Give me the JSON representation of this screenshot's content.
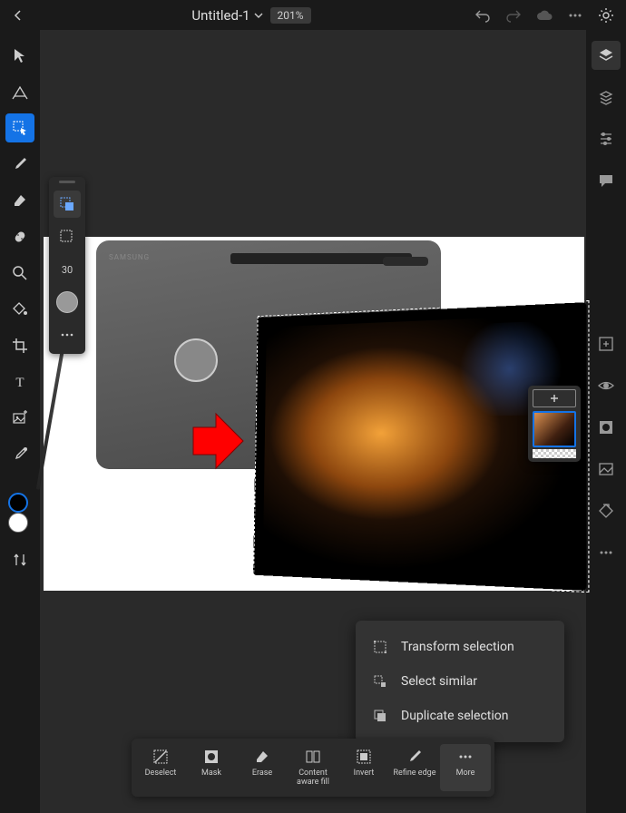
{
  "header": {
    "title": "Untitled-1",
    "zoom": "201%"
  },
  "left_tools": [
    {
      "name": "move-tool"
    },
    {
      "name": "transform-tool"
    },
    {
      "name": "selection-tool",
      "selected": true
    },
    {
      "name": "brush-tool"
    },
    {
      "name": "eraser-tool"
    },
    {
      "name": "heal-tool"
    },
    {
      "name": "magnify-tool"
    },
    {
      "name": "fill-tool"
    },
    {
      "name": "crop-tool"
    },
    {
      "name": "type-tool"
    },
    {
      "name": "place-tool"
    },
    {
      "name": "eyedropper-tool"
    }
  ],
  "tool_flyout": {
    "mode_active": "add",
    "mode_b": "subtract",
    "brush_size": "30",
    "shape": "round"
  },
  "colors": {
    "foreground": "#000000",
    "background": "#ffffff"
  },
  "right_tools": [
    {
      "name": "layers-panel",
      "selected": true
    },
    {
      "name": "layer-props-panel"
    },
    {
      "name": "adjustments-panel"
    },
    {
      "name": "comments-panel"
    }
  ],
  "right_tools_lower": [
    {
      "name": "add-layer-button"
    },
    {
      "name": "visibility-button"
    },
    {
      "name": "mask-button"
    },
    {
      "name": "image-button"
    },
    {
      "name": "clear-button"
    },
    {
      "name": "more-panel-button"
    }
  ],
  "popup": {
    "items": [
      {
        "icon": "transform-selection-icon",
        "label": "Transform selection"
      },
      {
        "icon": "select-similar-icon",
        "label": "Select similar"
      },
      {
        "icon": "duplicate-selection-icon",
        "label": "Duplicate selection"
      }
    ]
  },
  "bottom": {
    "items": [
      {
        "icon": "deselect-icon",
        "label": "Deselect"
      },
      {
        "icon": "mask-icon",
        "label": "Mask"
      },
      {
        "icon": "erase-icon",
        "label": "Erase"
      },
      {
        "icon": "content-aware-fill-icon",
        "label": "Content aware fill"
      },
      {
        "icon": "invert-icon",
        "label": "Invert"
      },
      {
        "icon": "refine-edge-icon",
        "label": "Refine edge"
      },
      {
        "icon": "more-icon",
        "label": "More",
        "selected": true
      }
    ]
  },
  "canvas": {
    "brand_text": "SAMSUNG"
  }
}
